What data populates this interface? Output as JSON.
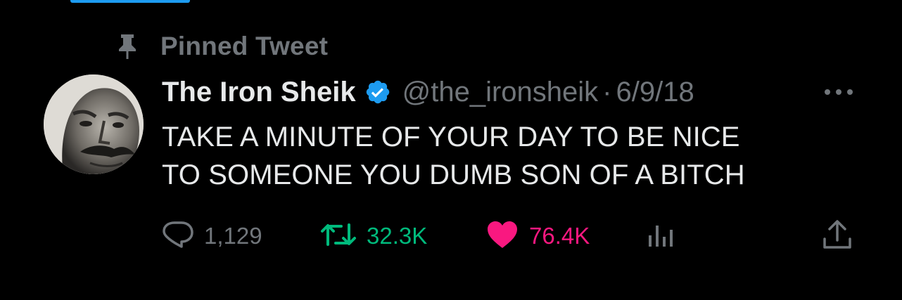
{
  "pinned": {
    "label": "Pinned Tweet",
    "icon": "pin-icon"
  },
  "tweet": {
    "display_name": "The Iron Sheik",
    "verified": true,
    "handle": "@the_ironsheik",
    "separator": "·",
    "date": "6/9/18",
    "text_line1": "TAKE A MINUTE OF YOUR DAY TO BE NICE",
    "text_line2": "TO SOMEONE YOU DUMB SON OF A BITCH"
  },
  "actions": {
    "replies": "1,129",
    "retweets": "32.3K",
    "likes": "76.4K",
    "liked": true,
    "retweeted": true
  },
  "colors": {
    "background": "#000000",
    "primary_text": "#e7e9ea",
    "secondary_text": "#71767b",
    "verified": "#1d9bf0",
    "retweet_active": "#00ba7c",
    "like_active": "#f91880"
  }
}
